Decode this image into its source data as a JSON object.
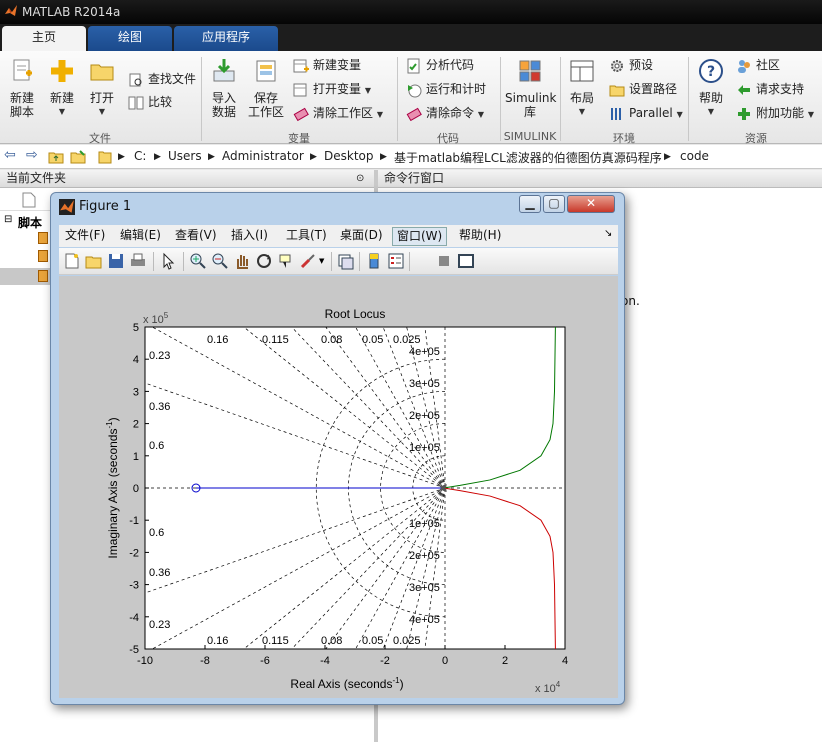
{
  "app": {
    "title": "MATLAB R2014a"
  },
  "tabs": [
    {
      "label": "主页"
    },
    {
      "label": "绘图"
    },
    {
      "label": "应用程序"
    }
  ],
  "ribbon": {
    "file_group": {
      "label": "文件",
      "new_script": "新建\n脚本",
      "new": "新建",
      "open": "打开",
      "find_files": "查找文件",
      "compare": "比较"
    },
    "variable_group": {
      "label": "变量",
      "import_data": "导入\n数据",
      "save_workspace": "保存\n工作区",
      "new_variable": "新建变量",
      "open_variable": "打开变量",
      "clear_workspace": "清除工作区"
    },
    "code_group": {
      "label": "代码",
      "analyze_code": "分析代码",
      "run_and_time": "运行和计时",
      "clear_commands": "清除命令"
    },
    "simulink_group": {
      "label": "SIMULINK",
      "simulink_lib": "Simulink\n库"
    },
    "env_group": {
      "label": "环境",
      "layout": "布局",
      "preferences": "预设",
      "set_path": "设置路径",
      "parallel": "Parallel"
    },
    "resources_group": {
      "label": "资源",
      "help": "帮助",
      "community": "社区",
      "request_support": "请求支持",
      "addons": "附加功能"
    }
  },
  "address": {
    "crumbs": [
      "C:",
      "Users",
      "Administrator",
      "Desktop",
      "基于matlab编程LCL滤波器的伯德图仿真源码程序",
      "code"
    ]
  },
  "panes": {
    "current_folder": "当前文件夹",
    "command_window": "命令行窗口",
    "scripts_group": "脚本",
    "cmd_fragment": "on."
  },
  "figure": {
    "title": "Figure 1",
    "menus": [
      "文件(F)",
      "编辑(E)",
      "查看(V)",
      "插入(I)",
      "工具(T)",
      "桌面(D)",
      "窗口(W)",
      "帮助(H)"
    ]
  },
  "chart_data": {
    "type": "line",
    "title": "Root Locus",
    "xlabel": "Real Axis (seconds",
    "xlabel_sup": "-1",
    "ylabel": "Imaginary Axis (seconds",
    "ylabel_sup": "-1",
    "x_multiplier": "x 10",
    "x_multiplier_exp": "4",
    "y_multiplier": "x 10",
    "y_multiplier_exp": "5",
    "xlim": [
      -100000,
      40000
    ],
    "ylim": [
      -500000,
      500000
    ],
    "x_ticks": [
      -10,
      -8,
      -6,
      -4,
      -2,
      0,
      2,
      4
    ],
    "y_ticks": [
      5,
      4,
      3,
      2,
      1,
      0,
      -1,
      -2,
      -3,
      -4,
      -5
    ],
    "damping_labels": [
      "0.16",
      "0.115",
      "0.08",
      "0.05",
      "0.025",
      "0.23",
      "0.36",
      "0.6"
    ],
    "frequency_labels": [
      "4e+05",
      "3e+05",
      "2e+05",
      "1e+05"
    ],
    "zero": {
      "x": -83000,
      "y": 0
    },
    "poles": [
      {
        "x": -1000,
        "y": 0
      },
      {
        "x": -500,
        "y": 2000
      },
      {
        "x": -500,
        "y": -2000
      }
    ],
    "series": [
      {
        "color": "#0000cc",
        "points": [
          [
            -83000,
            0
          ],
          [
            -1000,
            0
          ]
        ]
      },
      {
        "color": "#007700",
        "points": [
          [
            -500,
            0
          ],
          [
            5000,
            8000
          ],
          [
            15000,
            25000
          ],
          [
            25000,
            55000
          ],
          [
            32000,
            100000
          ],
          [
            35000,
            150000
          ],
          [
            36000,
            200000
          ],
          [
            36500,
            300000
          ],
          [
            36800,
            500000
          ]
        ]
      },
      {
        "color": "#cc0000",
        "points": [
          [
            -500,
            0
          ],
          [
            5000,
            -8000
          ],
          [
            15000,
            -25000
          ],
          [
            25000,
            -55000
          ],
          [
            32000,
            -100000
          ],
          [
            35000,
            -150000
          ],
          [
            36000,
            -200000
          ],
          [
            36500,
            -300000
          ],
          [
            36800,
            -500000
          ]
        ]
      }
    ],
    "grid": true,
    "colors": {
      "axes_bg": "#ffffff",
      "figure_bg": "#c8c8c8",
      "grid": "#000000"
    }
  }
}
